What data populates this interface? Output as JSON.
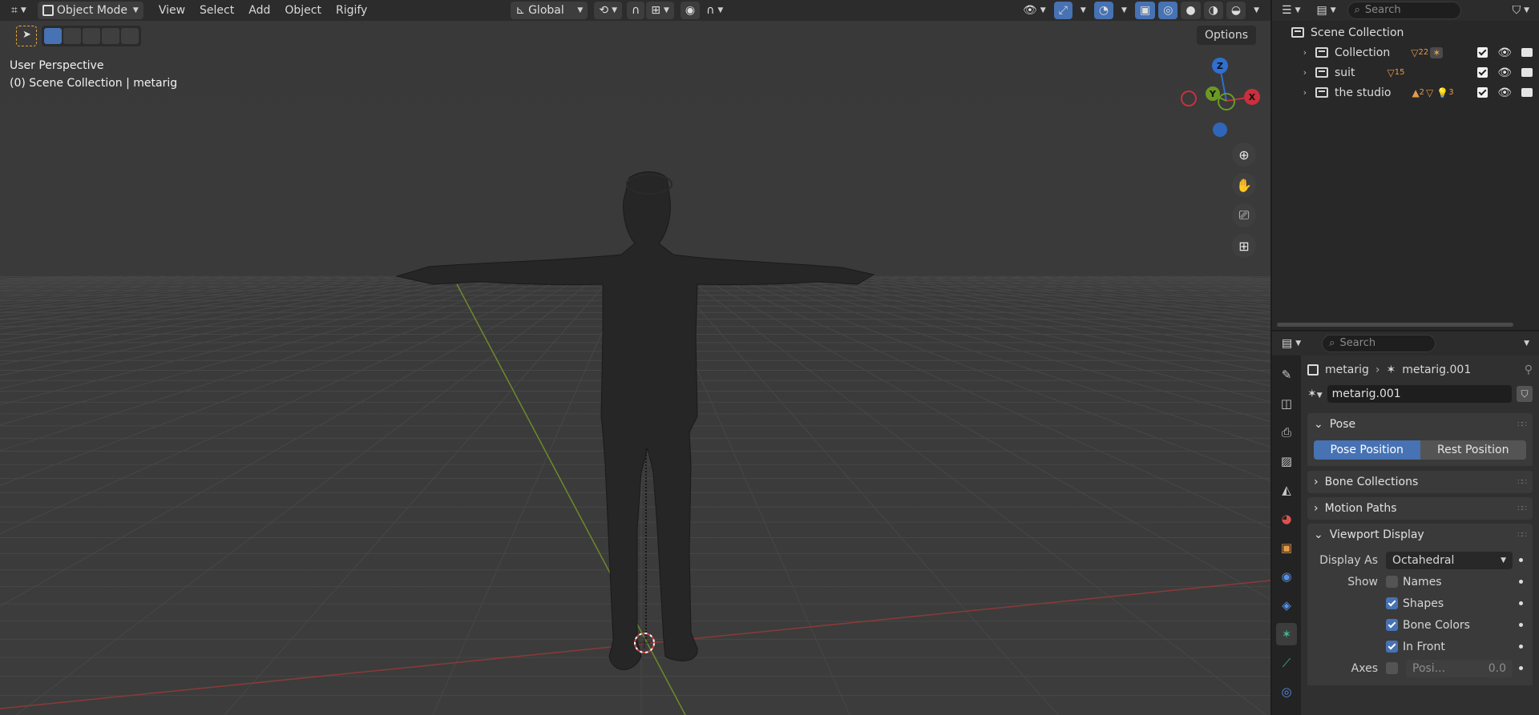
{
  "viewport": {
    "editor_type_icon": "3d-viewport-icon",
    "mode": "Object Mode",
    "menus": [
      "View",
      "Select",
      "Add",
      "Object",
      "Rigify"
    ],
    "transform_orientation": "Global",
    "options_label": "Options",
    "overlay_line1": "User Perspective",
    "overlay_line2": "(0) Scene Collection | metarig",
    "gizmo": {
      "z": "Z",
      "y": "Y",
      "x": "X"
    }
  },
  "outliner": {
    "search_placeholder": "Search",
    "scene_collection": "Scene Collection",
    "rows": [
      {
        "label": "Collection",
        "count": "22"
      },
      {
        "label": "suit",
        "count": "15"
      },
      {
        "label": "the studio",
        "count_a": "2",
        "count_b": "3"
      }
    ]
  },
  "properties": {
    "search_placeholder": "Search",
    "breadcrumb": {
      "object": "metarig",
      "data": "metarig.001"
    },
    "armature_name": "metarig.001",
    "pose_panel": {
      "title": "Pose",
      "pose_position": "Pose Position",
      "rest_position": "Rest Position"
    },
    "bone_collections": "Bone Collections",
    "motion_paths": "Motion Paths",
    "viewport_display": {
      "title": "Viewport Display",
      "display_as_label": "Display As",
      "display_as_value": "Octahedral",
      "show_label": "Show",
      "names": "Names",
      "shapes": "Shapes",
      "bone_colors": "Bone Colors",
      "in_front": "In Front",
      "axes_label": "Axes",
      "axes_position_label": "Posi...",
      "axes_position_value": "0.0"
    }
  },
  "colors": {
    "accent": "#4772b3",
    "x_axis": "#c9303e",
    "y_axis": "#6b9a23",
    "z_axis": "#2f6fd0"
  }
}
